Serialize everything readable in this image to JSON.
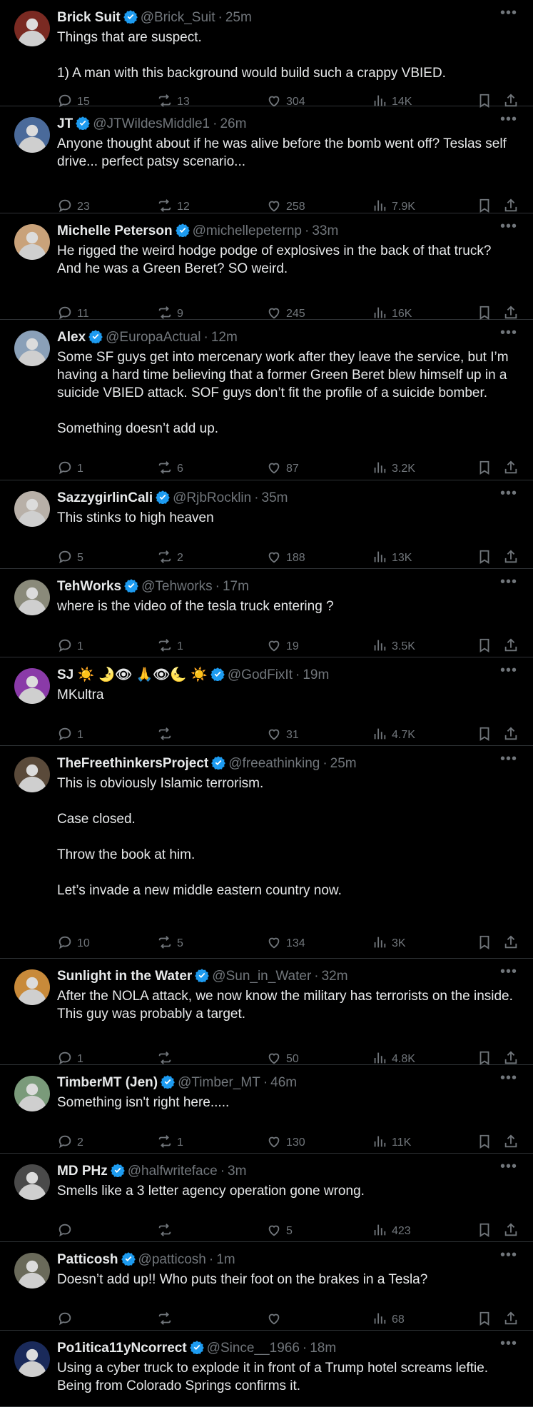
{
  "colors": {
    "background": "#000000",
    "text": "#e7e9ea",
    "muted": "#71767b",
    "verified": "#1d9bf0",
    "divider": "#2f3336"
  },
  "icons": {
    "reply": "reply-icon",
    "retweet": "retweet-icon",
    "like": "heart-icon",
    "views": "views-icon",
    "bookmark": "bookmark-icon",
    "share": "share-icon",
    "more": "more-icon",
    "verified": "verified-badge-icon"
  },
  "tweets": [
    {
      "name": "Brick Suit",
      "handle": "@Brick_Suit",
      "time": "25m",
      "body": [
        "Things that are suspect.",
        "",
        "1) A man with this background would build such a crappy VBIED."
      ],
      "replies": "15",
      "retweets": "13",
      "likes": "304",
      "views": "14K",
      "avatar_color": "#7a2a22"
    },
    {
      "name": "JT",
      "handle": "@JTWildesMiddle1",
      "time": "26m",
      "body": [
        "Anyone thought about if he was alive before the bomb went off? Teslas self drive... perfect patsy scenario..."
      ],
      "replies": "23",
      "retweets": "12",
      "likes": "258",
      "views": "7.9K",
      "avatar_color": "#4a6a9a"
    },
    {
      "name": "Michelle Peterson",
      "handle": "@michellepeternp",
      "time": "33m",
      "body": [
        "He rigged the weird hodge podge of explosives in the back of that truck? And he was a Green Beret? SO weird."
      ],
      "replies": "11",
      "retweets": "9",
      "likes": "245",
      "views": "16K",
      "avatar_color": "#c9a27a"
    },
    {
      "name": "Alex",
      "handle": "@EuropaActual",
      "time": "12m",
      "body": [
        "Some SF guys get into mercenary work after they leave the service, but I’m having a hard time believing that a former Green Beret blew himself up in a suicide VBIED attack. SOF guys don’t fit the profile of a suicide bomber.",
        "",
        "Something doesn’t add up."
      ],
      "replies": "1",
      "retweets": "6",
      "likes": "87",
      "views": "3.2K",
      "avatar_color": "#8aa0b8"
    },
    {
      "name": "SazzygirlinCali",
      "handle": "@RjbRocklin",
      "time": "35m",
      "body": [
        "This stinks to high heaven"
      ],
      "replies": "5",
      "retweets": "2",
      "likes": "188",
      "views": "13K",
      "avatar_color": "#b8b0a8"
    },
    {
      "name": "TehWorks",
      "handle": "@Tehworks",
      "time": "17m",
      "body": [
        "where is the video of the tesla truck entering ?"
      ],
      "replies": "1",
      "retweets": "1",
      "likes": "19",
      "views": "3.5K",
      "avatar_color": "#8a8a7a"
    },
    {
      "name": "SJ ☀️ 🌛👁 🙏👁🌜 ☀️",
      "handle": "@GodFixIt",
      "time": "19m",
      "body": [
        "MKultra"
      ],
      "replies": "1",
      "retweets": "",
      "likes": "31",
      "views": "4.7K",
      "avatar_color": "#8a3aa8"
    },
    {
      "name": "TheFreethinkersProject",
      "handle": "@freeathinking",
      "time": "25m",
      "body": [
        "This is obviously Islamic terrorism.",
        "",
        "Case closed.",
        "",
        "Throw the book at him.",
        "",
        "Let’s invade a new middle eastern country now."
      ],
      "replies": "10",
      "retweets": "5",
      "likes": "134",
      "views": "3K",
      "avatar_color": "#5a4a3a"
    },
    {
      "name": "Sunlight in the Water",
      "handle": "@Sun_in_Water",
      "time": "32m",
      "body": [
        "After the NOLA attack, we now know the military has terrorists on the inside. This guy was probably a target."
      ],
      "replies": "1",
      "retweets": "",
      "likes": "50",
      "views": "4.8K",
      "avatar_color": "#c88a3a"
    },
    {
      "name": "TimberMT (Jen)",
      "handle": "@Timber_MT",
      "time": "46m",
      "body": [
        "Something isn't right here....."
      ],
      "replies": "2",
      "retweets": "1",
      "likes": "130",
      "views": "11K",
      "avatar_color": "#7a9a7a"
    },
    {
      "name": "MD PHz",
      "handle": "@halfwriteface",
      "time": "3m",
      "body": [
        "Smells like a 3 letter agency operation gone wrong."
      ],
      "replies": "",
      "retweets": "",
      "likes": "5",
      "views": "423",
      "avatar_color": "#4a4a4a"
    },
    {
      "name": "Patticosh",
      "handle": "@patticosh",
      "time": "1m",
      "body": [
        "Doesn’t add up!! Who puts their foot on the brakes in a Tesla?"
      ],
      "replies": "",
      "retweets": "",
      "likes": "",
      "views": "68",
      "avatar_color": "#6a6a5a"
    },
    {
      "name": "Po1itica11yNcorrect",
      "handle": "@Since__1966",
      "time": "18m",
      "body": [
        "Using a cyber truck to explode it in front of a Trump hotel screams leftie. Being from Colorado Springs confirms it."
      ],
      "replies": "",
      "retweets": "",
      "likes": "",
      "views": "",
      "avatar_color": "#1a2a5a"
    }
  ]
}
